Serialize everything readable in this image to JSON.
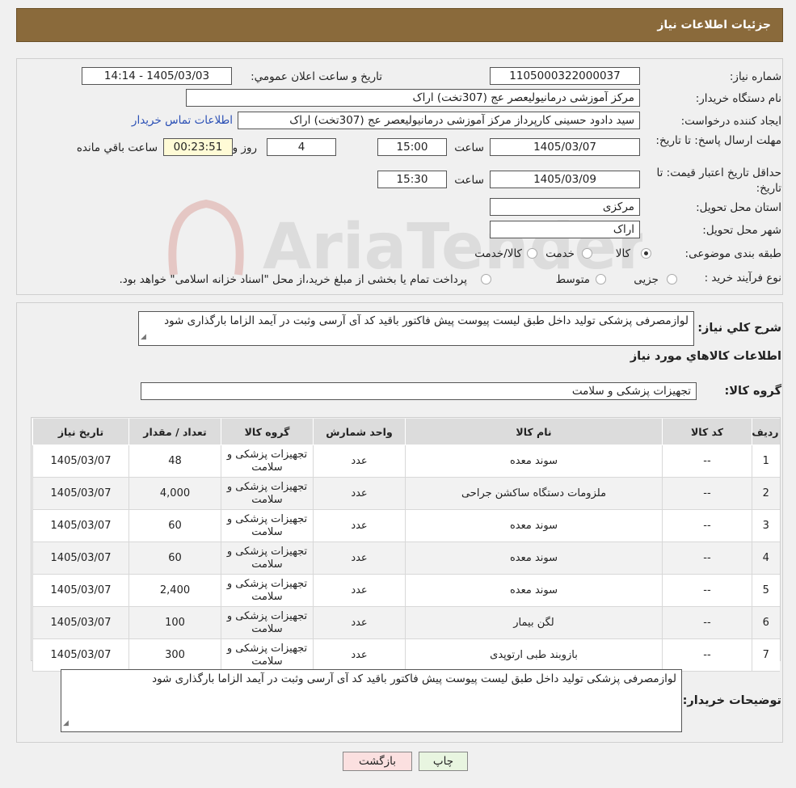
{
  "header": {
    "title": "جزئیات اطلاعات نیاز"
  },
  "form": {
    "need_number_label": "شماره نیاز:",
    "need_number": "1105000322000037",
    "announce_label": "تاريخ و ساعت اعلان عمومي:",
    "announce_value": "1405/03/03 - 14:14",
    "buyer_org_label": "نام دستگاه خریدار:",
    "buyer_org": "مرکز آموزشی درمانیولیعصر عج (307تخت) اراک",
    "requester_label": "ایجاد کننده درخواست:",
    "requester": "سید دادود حسینی کارپرداز مرکز آموزشی درمانیولیعصر عج (307تخت) اراک",
    "contact_link": "اطلاعات تماس خریدار",
    "reply_deadline_label": "مهلت ارسال پاسخ: تا تاریخ:",
    "reply_date": "1405/03/07",
    "time_label": "ساعت",
    "reply_time": "15:00",
    "days_value": "4",
    "days_label": "روز و",
    "remaining_time": "00:23:51",
    "remaining_label": "ساعت باقي مانده",
    "price_validity_label": "حداقل تاریخ اعتبار قیمت: تا تاریخ:",
    "validity_date": "1405/03/09",
    "validity_time": "15:30",
    "province_label": "استان محل تحویل:",
    "province": "مرکزی",
    "city_label": "شهر محل تحویل:",
    "city": "اراک",
    "category_label": "طبقه بندی موضوعی:",
    "category_options": [
      "کالا",
      "خدمت",
      "کالا/خدمت"
    ],
    "process_label": "نوع فرآیند خرید :",
    "process_options": [
      "جزیی",
      "متوسط"
    ],
    "process_note": "پرداخت تمام یا بخشی از مبلغ خرید،از محل \"اسناد خزانه اسلامی\" خواهد بود."
  },
  "description": {
    "label": "شرح کلي نياز:",
    "text": "لوازمصرفی پزشکی تولید داخل  طبق لیست پیوست پیش فاکتور باقید کد آی آرسی وثبت در آیمد الزاما بارگذاری شود"
  },
  "goods": {
    "section_title": "اطلاعات کالاهاي مورد نياز",
    "group_label": "گروه کالا:",
    "group_value": "تجهیزات پزشکی و سلامت",
    "columns": [
      "رديف",
      "کد کالا",
      "نام کالا",
      "واحد شمارش",
      "گروه کالا",
      "تعداد / مقدار",
      "تاريخ نياز"
    ],
    "rows": [
      [
        "1",
        "--",
        "سوند معده",
        "عدد",
        "تجهیزات پزشکی و سلامت",
        "48",
        "1405/03/07"
      ],
      [
        "2",
        "--",
        "ملزومات دستگاه ساکشن جراحی",
        "عدد",
        "تجهیزات پزشکی و سلامت",
        "4,000",
        "1405/03/07"
      ],
      [
        "3",
        "--",
        "سوند معده",
        "عدد",
        "تجهیزات پزشکی و سلامت",
        "60",
        "1405/03/07"
      ],
      [
        "4",
        "--",
        "سوند معده",
        "عدد",
        "تجهیزات پزشکی و سلامت",
        "60",
        "1405/03/07"
      ],
      [
        "5",
        "--",
        "سوند معده",
        "عدد",
        "تجهیزات پزشکی و سلامت",
        "2,400",
        "1405/03/07"
      ],
      [
        "6",
        "--",
        "لگن بیمار",
        "عدد",
        "تجهیزات پزشکی و سلامت",
        "100",
        "1405/03/07"
      ],
      [
        "7",
        "--",
        "بازوبند طبی ارتوپدی",
        "عدد",
        "تجهیزات پزشکی و سلامت",
        "300",
        "1405/03/07"
      ]
    ]
  },
  "buyer_notes": {
    "label": "توضیحات خریدار:",
    "text": "لوازمصرفی پزشکی تولید داخل  طبق لیست پیوست پیش فاکتور باقید کد آی آرسی وثبت در آیمد الزاما بارگذاری شود"
  },
  "buttons": {
    "print": "چاپ",
    "back": "بازگشت"
  },
  "colors": {
    "header_bg": "#8a6a3b",
    "link": "#2a4fb5",
    "back_button_bg": "#fbe0e0",
    "print_button_bg": "#e8f5e0"
  }
}
